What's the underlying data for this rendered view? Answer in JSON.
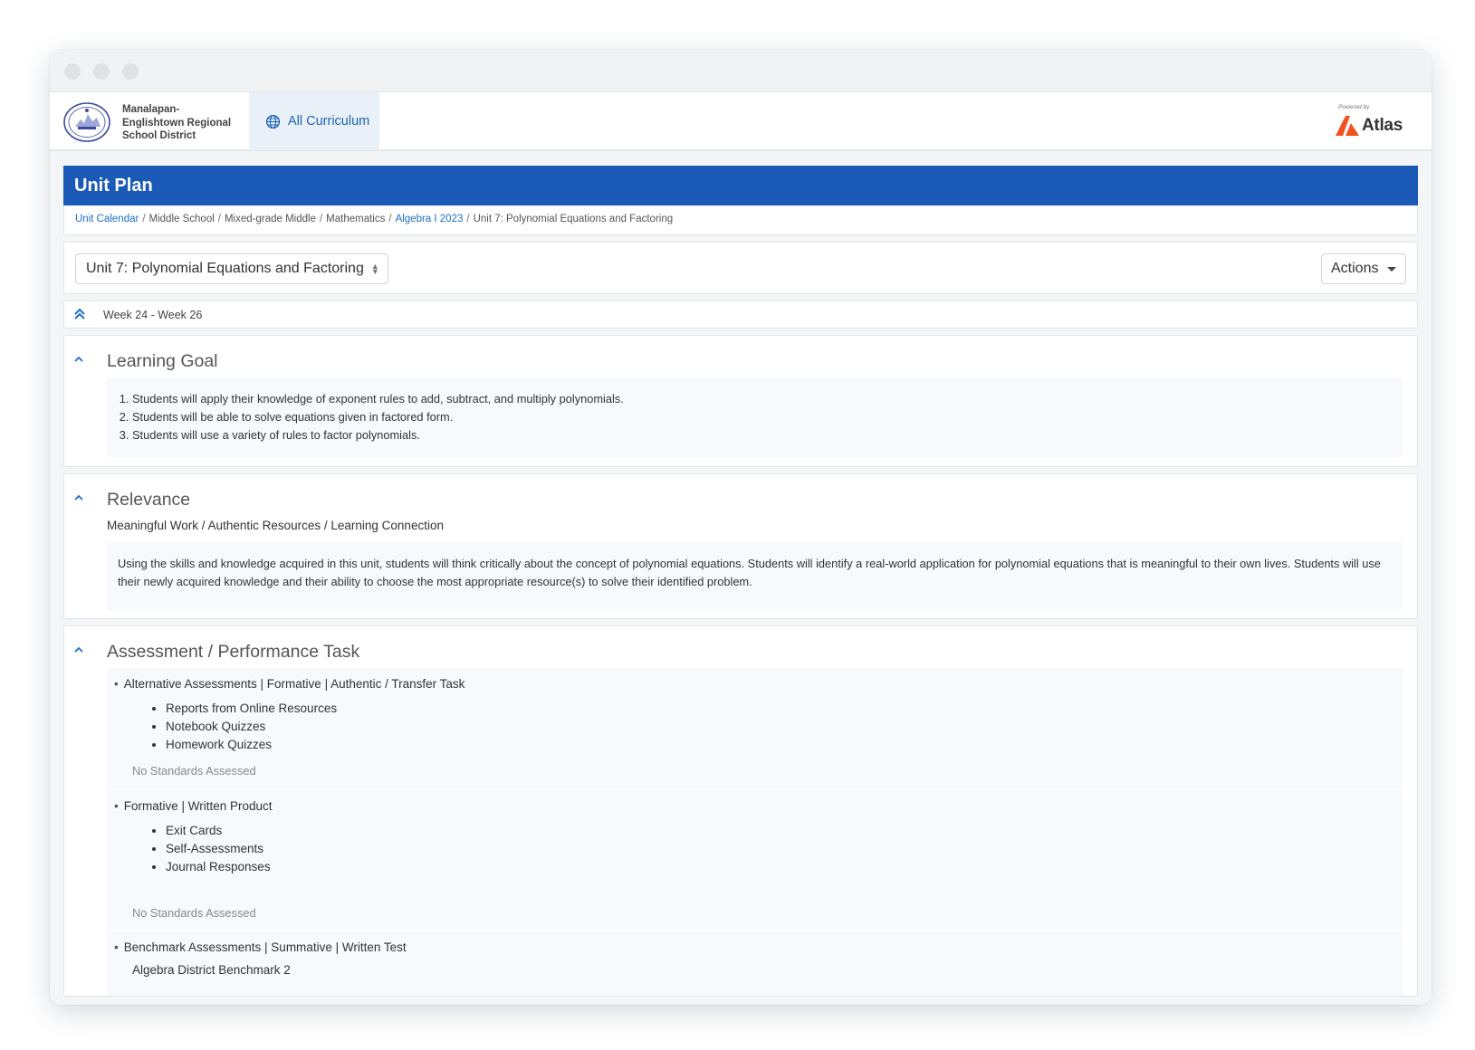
{
  "header": {
    "district_name": [
      "Manalapan-",
      "Englishtown Regional",
      "School District"
    ],
    "nav_all_curriculum": "All Curriculum",
    "powered_by": "Powered by",
    "brand": "Atlas"
  },
  "page": {
    "title": "Unit Plan",
    "breadcrumb": [
      {
        "label": "Unit Calendar",
        "link": true
      },
      {
        "label": "Middle School",
        "link": false
      },
      {
        "label": "Mixed-grade Middle",
        "link": false
      },
      {
        "label": "Mathematics",
        "link": false
      },
      {
        "label": "Algebra I 2023",
        "link": true
      },
      {
        "label": "Unit 7: Polynomial Equations and Factoring",
        "link": false
      }
    ],
    "unit_select_value": "Unit 7: Polynomial Equations and Factoring",
    "actions_label": "Actions",
    "week_range": "Week 24 - Week 26"
  },
  "learning_goal": {
    "title": "Learning Goal",
    "items": [
      "Students will apply their knowledge of exponent rules to add, subtract, and multiply polynomials.",
      "Students will be able to solve equations given in factored form.",
      "Students will use a variety of rules to factor polynomials."
    ]
  },
  "relevance": {
    "title": "Relevance",
    "subtitle": "Meaningful Work / Authentic Resources / Learning Connection",
    "text": "Using the skills and knowledge acquired in this unit, students will think critically about the concept of polynomial equations. Students will identify a real-world application for polynomial equations that is meaningful to their own lives. Students will use their newly acquired knowledge and their ability to choose the most appropriate resource(s) to solve their identified problem."
  },
  "assessment": {
    "title": "Assessment / Performance Task",
    "blocks": [
      {
        "heading": "Alternative Assessments | Formative | Authentic / Transfer Task",
        "items": [
          "Reports from Online Resources",
          "Notebook Quizzes",
          "Homework Quizzes"
        ],
        "standards": "No Standards Assessed"
      },
      {
        "heading": "Formative | Written Product",
        "items": [
          "Exit Cards",
          "Self-Assessments",
          "Journal Responses"
        ],
        "standards": "No Standards Assessed"
      },
      {
        "heading": "Benchmark Assessments | Summative | Written Test",
        "subtitle": "Algebra District Benchmark 2"
      }
    ]
  },
  "colors": {
    "banner": "#1b5ab6",
    "link": "#1b6fc9",
    "atlas_orange": "#f0521f"
  }
}
